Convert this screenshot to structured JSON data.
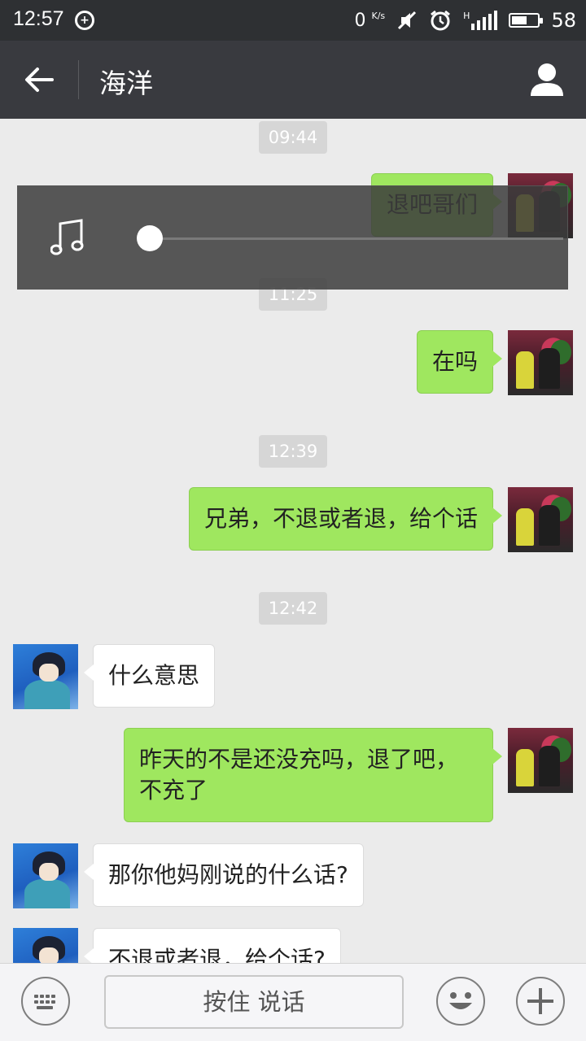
{
  "status_bar": {
    "time": "12:57",
    "net_speed": "0",
    "net_unit": "K/s",
    "signal_type": "H",
    "battery": "58",
    "battery_level_percent": 58,
    "icons": [
      "notification-icon",
      "mute-icon",
      "alarm-icon",
      "signal-icon",
      "battery-icon"
    ]
  },
  "header": {
    "title": "海洋",
    "back_icon": "back-arrow-icon",
    "profile_icon": "person-icon"
  },
  "messages": {
    "t1": "09:44",
    "m1": "退吧哥们",
    "t2": "11:25",
    "m2": "在吗",
    "t3": "12:39",
    "m3": "兄弟，不退或者退，给个话",
    "t4": "12:42",
    "m4": "什么意思",
    "m5": "昨天的不是还没充吗，退了吧，不充了",
    "m6": "那你他妈刚说的什么话?",
    "m7": "不退或者退，给个话?"
  },
  "player": {
    "icon": "music-note-icon",
    "progress": 0
  },
  "input_bar": {
    "hold_to_talk": "按住 说话",
    "keyboard_icon": "keyboard-icon",
    "emoji_icon": "emoji-icon",
    "plus_icon": "plus-icon"
  },
  "colors": {
    "sent_bubble": "#9fe75f",
    "received_bubble": "#ffffff",
    "header_bg": "#393a3f",
    "chat_bg": "#ebebeb"
  }
}
